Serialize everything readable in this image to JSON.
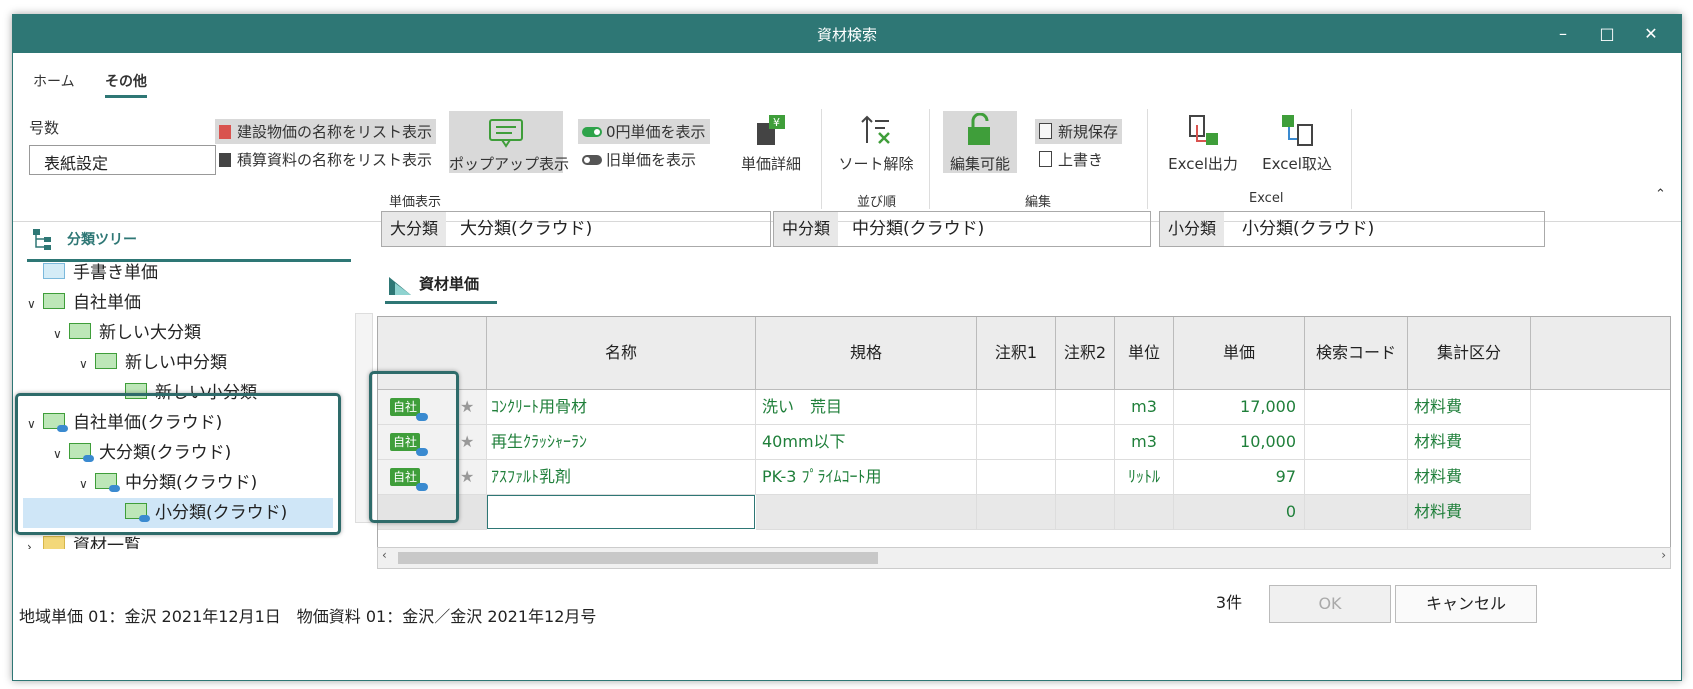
{
  "window": {
    "title": "資材検索"
  },
  "tabs": [
    {
      "label": "ホーム"
    },
    {
      "label": "その他"
    }
  ],
  "ribbon": {
    "number_label": "号数",
    "number_value": "表紙設定",
    "show_building_names": "建設物価の名称をリスト表示",
    "show_estimate_names": "積算資料の名称をリスト表示",
    "popup_display": "ポップアップ表示",
    "show_zero_price": "0円単価を表示",
    "show_old_price": "旧単価を表示",
    "price_detail": "単価詳細",
    "sort_clear": "ソート解除",
    "editable": "編集可能",
    "save_new": "新規保存",
    "overwrite": "上書き",
    "excel_export": "Excel出力",
    "excel_import": "Excel取込",
    "groups": {
      "price_display": "単価表示",
      "sort": "並び順",
      "edit": "編集",
      "excel": "Excel"
    }
  },
  "tree": {
    "header": "分類ツリー",
    "nodes": [
      {
        "label": "手書き単価"
      },
      {
        "label": "自社単価"
      },
      {
        "label": "新しい大分類"
      },
      {
        "label": "新しい中分類"
      },
      {
        "label": "新しい小分類"
      },
      {
        "label": "自社単価(クラウド)"
      },
      {
        "label": "大分類(クラウド)"
      },
      {
        "label": "中分類(クラウド)"
      },
      {
        "label": "小分類(クラウド)"
      },
      {
        "label": "資材一覧"
      }
    ]
  },
  "categories": {
    "large_label": "大分類",
    "large_value": "大分類(クラウド)",
    "mid_label": "中分類",
    "mid_value": "中分類(クラウド)",
    "small_label": "小分類",
    "small_value": "小分類(クラウド)"
  },
  "section_title": "資材単価",
  "table": {
    "headers": [
      "名称",
      "規格",
      "注釈1",
      "注釈2",
      "単位",
      "単価",
      "検索コード",
      "集計区分"
    ],
    "badge": "自社",
    "rows": [
      {
        "name": "ｺﾝｸﾘｰﾄ用骨材",
        "spec": "洗い　荒目",
        "unit": "m3",
        "price": "17,000",
        "category": "材料費"
      },
      {
        "name": "再生ｸﾗｯｼｬｰﾗﾝ",
        "spec": "40mm以下",
        "unit": "m3",
        "price": "10,000",
        "category": "材料費"
      },
      {
        "name": "ｱｽﾌｧﾙﾄ乳剤",
        "spec": "PK-3 ﾌﾟﾗｲﾑｺｰﾄ用",
        "unit": "ﾘｯﾄﾙ",
        "price": "97",
        "category": "材料費"
      },
      {
        "name": "",
        "spec": "",
        "unit": "",
        "price": "0",
        "category": "材料費"
      }
    ]
  },
  "status": {
    "text": "地域単価 01：金沢 2021年12月1日　物価資料 01：金沢／金沢 2021年12月号",
    "count": "3件",
    "ok": "OK",
    "cancel": "キャンセル"
  },
  "colors": {
    "accent": "#2e7775",
    "green_text": "#1f7f3a"
  }
}
